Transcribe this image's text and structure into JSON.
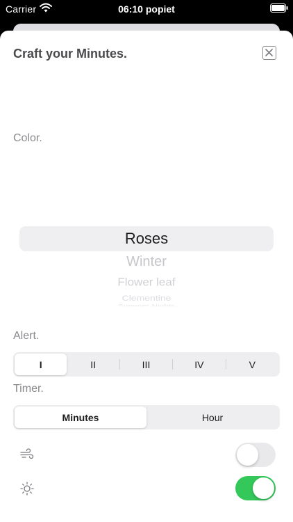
{
  "status_bar": {
    "carrier": "Carrier",
    "time": "06:10 popiet",
    "wifi_icon": "wifi-icon",
    "battery_icon": "battery-icon"
  },
  "sheet": {
    "title": "Craft your Minutes.",
    "close_icon": "close-icon"
  },
  "color_section": {
    "label": "Color.",
    "picker_items": [
      "Roses",
      "Winter",
      "Flower leaf",
      "Clementine",
      "Summer Nights"
    ],
    "selected": "Roses"
  },
  "alert_section": {
    "label": "Alert.",
    "segments": [
      "I",
      "II",
      "III",
      "IV",
      "V"
    ],
    "selected_index": 0
  },
  "timer_section": {
    "label": "Timer.",
    "segments": [
      "Minutes",
      "Hour"
    ],
    "selected_index": 0
  },
  "toggles": [
    {
      "icon": "wind-icon",
      "on": false
    },
    {
      "icon": "sun-icon",
      "on": true
    }
  ],
  "colors": {
    "toggle_on": "#34c759",
    "toggle_off": "#e9e9eb",
    "accent_text": "#1c1c1e",
    "label_gray": "#8a8a8e"
  }
}
